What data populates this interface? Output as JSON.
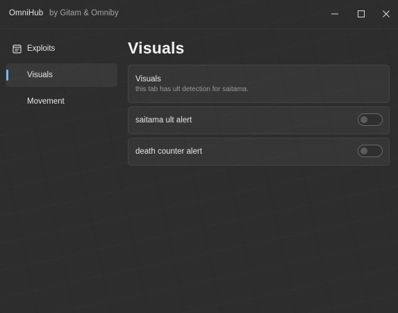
{
  "window": {
    "title": "OmniHub",
    "subtitle": "by Gitam & Omniby",
    "controls": {
      "minimize_icon": "minimize-icon",
      "maximize_icon": "maximize-icon",
      "close_icon": "close-icon"
    }
  },
  "sidebar": {
    "items": [
      {
        "label": "Exploits",
        "icon": "document-icon",
        "active": false
      },
      {
        "label": "Visuals",
        "icon": "",
        "active": true
      },
      {
        "label": "Movement",
        "icon": "",
        "active": false
      }
    ]
  },
  "main": {
    "title": "Visuals",
    "header_card": {
      "title": "Visuals",
      "description": "this tab has ult detection for saitama."
    },
    "toggles": [
      {
        "label": "saitama ult alert",
        "enabled": false
      },
      {
        "label": "death counter alert",
        "enabled": false
      }
    ]
  },
  "colors": {
    "accent": "#76b9ed",
    "background": "#2d2d2d",
    "card": "#353535"
  }
}
